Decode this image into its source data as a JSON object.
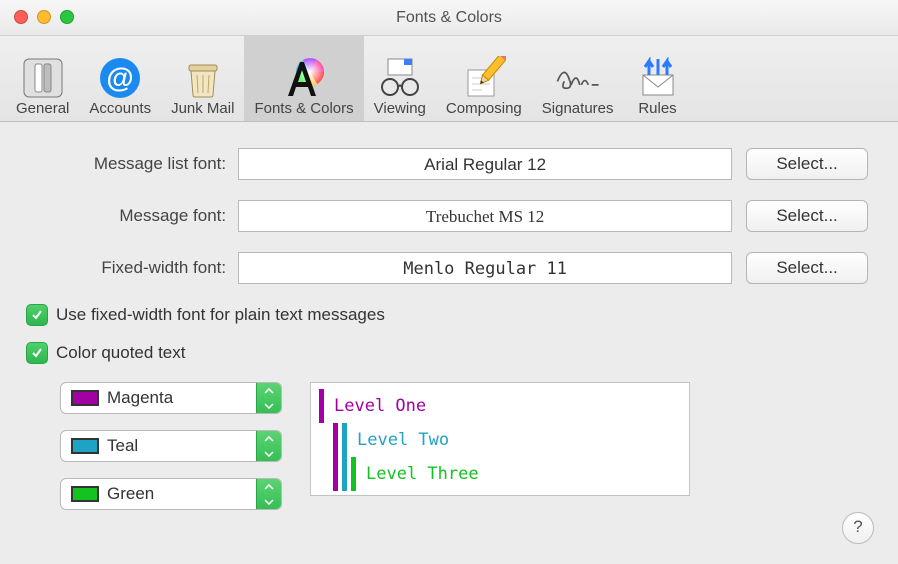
{
  "window_title": "Fonts & Colors",
  "toolbar": {
    "items": [
      {
        "label": "General",
        "icon": "switch-icon"
      },
      {
        "label": "Accounts",
        "icon": "at-icon"
      },
      {
        "label": "Junk Mail",
        "icon": "trash-icon"
      },
      {
        "label": "Fonts & Colors",
        "icon": "font-color-icon",
        "active": true
      },
      {
        "label": "Viewing",
        "icon": "glasses-icon"
      },
      {
        "label": "Composing",
        "icon": "pencil-icon"
      },
      {
        "label": "Signatures",
        "icon": "signature-icon"
      },
      {
        "label": "Rules",
        "icon": "rules-icon"
      }
    ]
  },
  "font_rows": {
    "message_list": {
      "label": "Message list font:",
      "value": "Arial Regular 12",
      "font_css": "Arial"
    },
    "message": {
      "label": "Message font:",
      "value": "Trebuchet MS 12",
      "font_css": "'Trebuchet MS'"
    },
    "fixed_width": {
      "label": "Fixed-width font:",
      "value": "Menlo Regular 11",
      "font_css": "Menlo, monospace"
    },
    "select_button": "Select..."
  },
  "checkboxes": {
    "use_fixed_width": "Use fixed-width font for plain text messages",
    "color_quoted": "Color quoted text"
  },
  "quote_colors": [
    {
      "name": "Magenta",
      "hex": "#a200a4"
    },
    {
      "name": "Teal",
      "hex": "#1fa3c4"
    },
    {
      "name": "Green",
      "hex": "#12c321"
    }
  ],
  "quote_preview": [
    {
      "text": "Level One",
      "color": "#a200a4",
      "indent": 0
    },
    {
      "text": "Level Two",
      "color": "#1fa3c4",
      "indent": 1
    },
    {
      "text": "Level Three",
      "color": "#12c321",
      "indent": 2
    }
  ],
  "help_button": "?"
}
